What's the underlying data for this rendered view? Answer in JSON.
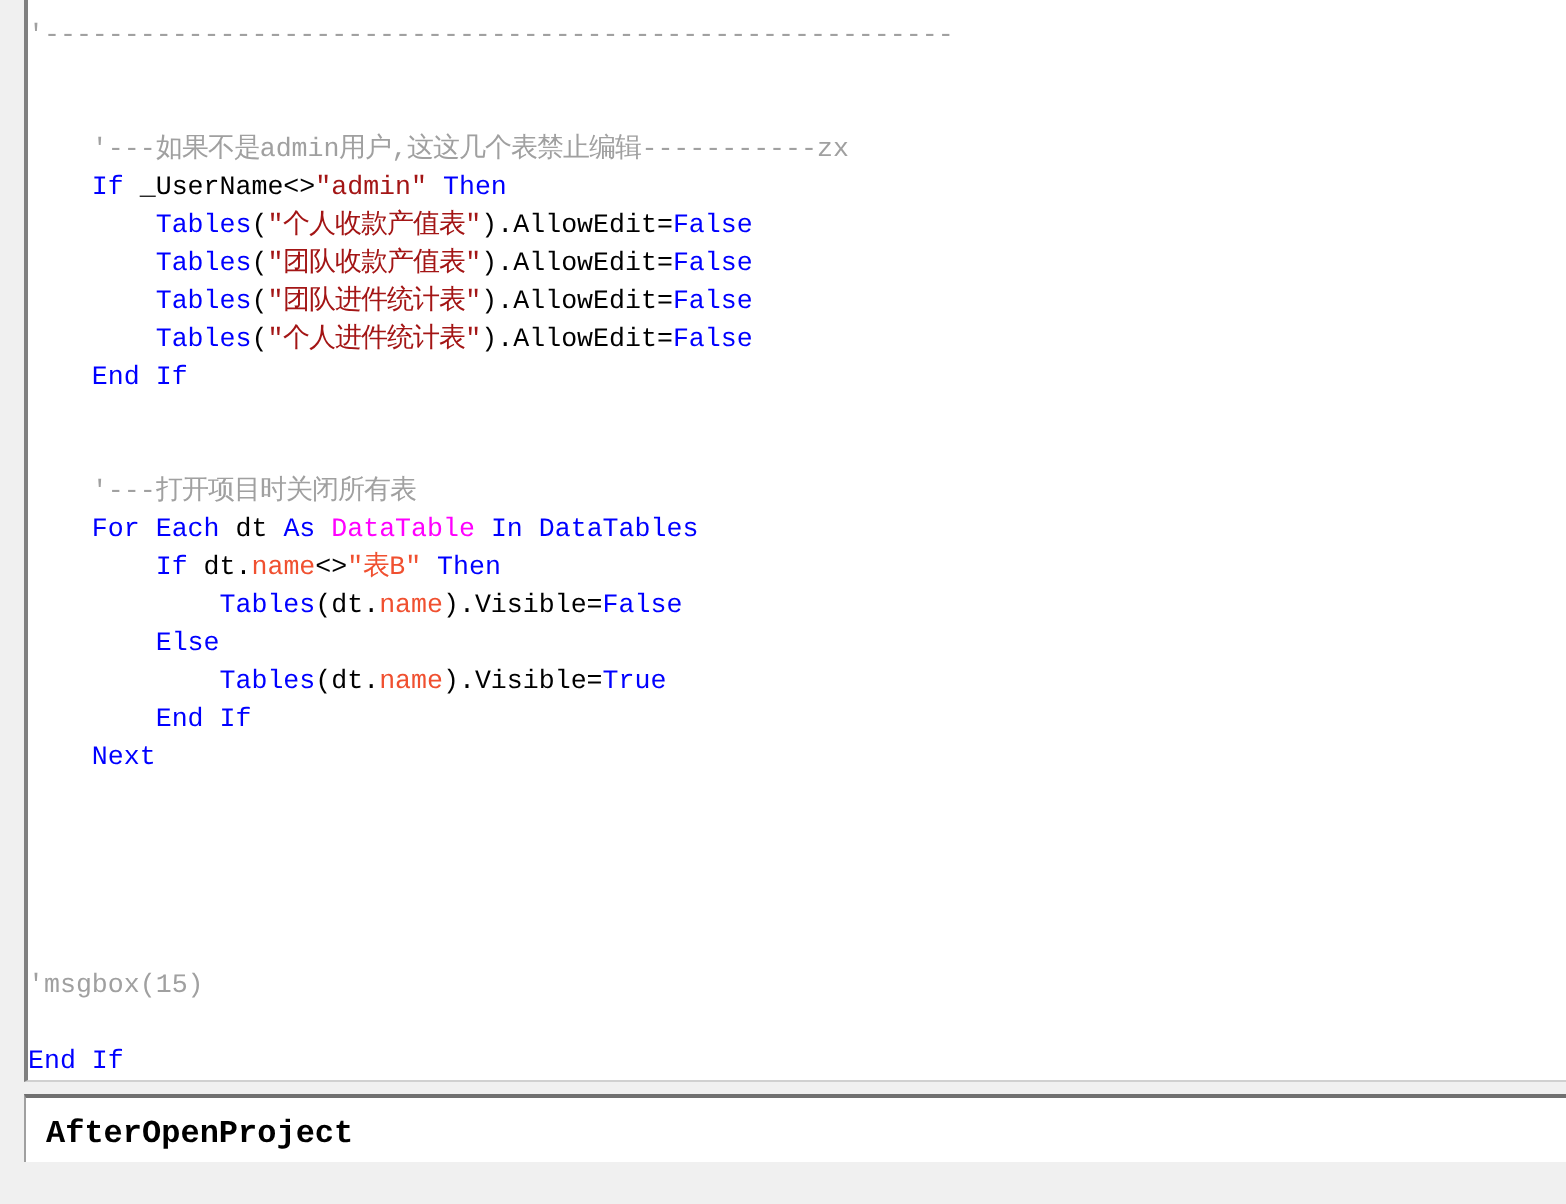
{
  "editor": {
    "lines": [
      {
        "tokens": [
          {
            "kind": "comment",
            "text": "'---------------------------------------------------------"
          }
        ]
      },
      {
        "kind": "blank"
      },
      {
        "kind": "blank"
      },
      {
        "tokens": [
          {
            "kind": "comment",
            "text": "    '---如果不是admin用户,这这几个表禁止编辑-----------zx"
          }
        ]
      },
      {
        "tokens": [
          {
            "kind": "keyword",
            "text": "    If "
          },
          {
            "kind": "plain",
            "text": "_UserName<>"
          },
          {
            "kind": "string",
            "text": "\"admin\""
          },
          {
            "kind": "keyword",
            "text": " Then"
          }
        ]
      },
      {
        "tokens": [
          {
            "kind": "keyword",
            "text": "        Tables"
          },
          {
            "kind": "plain",
            "text": "("
          },
          {
            "kind": "string",
            "text": "\"个人收款产值表\""
          },
          {
            "kind": "plain",
            "text": ").AllowEdit="
          },
          {
            "kind": "keyword",
            "text": "False"
          }
        ]
      },
      {
        "tokens": [
          {
            "kind": "keyword",
            "text": "        Tables"
          },
          {
            "kind": "plain",
            "text": "("
          },
          {
            "kind": "string",
            "text": "\"团队收款产值表\""
          },
          {
            "kind": "plain",
            "text": ").AllowEdit="
          },
          {
            "kind": "keyword",
            "text": "False"
          }
        ]
      },
      {
        "tokens": [
          {
            "kind": "keyword",
            "text": "        Tables"
          },
          {
            "kind": "plain",
            "text": "("
          },
          {
            "kind": "string",
            "text": "\"团队进件统计表\""
          },
          {
            "kind": "plain",
            "text": ").AllowEdit="
          },
          {
            "kind": "keyword",
            "text": "False"
          }
        ]
      },
      {
        "tokens": [
          {
            "kind": "keyword",
            "text": "        Tables"
          },
          {
            "kind": "plain",
            "text": "("
          },
          {
            "kind": "string",
            "text": "\"个人进件统计表\""
          },
          {
            "kind": "plain",
            "text": ").AllowEdit="
          },
          {
            "kind": "keyword",
            "text": "False"
          }
        ]
      },
      {
        "tokens": [
          {
            "kind": "keyword",
            "text": "    End If"
          }
        ]
      },
      {
        "kind": "blank"
      },
      {
        "kind": "blank"
      },
      {
        "tokens": [
          {
            "kind": "comment",
            "text": "    '---打开项目时关闭所有表"
          }
        ]
      },
      {
        "tokens": [
          {
            "kind": "keyword",
            "text": "    For Each "
          },
          {
            "kind": "plain",
            "text": "dt "
          },
          {
            "kind": "keyword",
            "text": "As "
          },
          {
            "kind": "type",
            "text": "DataTable"
          },
          {
            "kind": "keyword",
            "text": " In DataTables"
          }
        ]
      },
      {
        "tokens": [
          {
            "kind": "keyword",
            "text": "        If "
          },
          {
            "kind": "plain",
            "text": "dt."
          },
          {
            "kind": "member",
            "text": "name"
          },
          {
            "kind": "plain",
            "text": "<>"
          },
          {
            "kind": "member",
            "text": "\"表B\""
          },
          {
            "kind": "keyword",
            "text": " Then"
          }
        ]
      },
      {
        "tokens": [
          {
            "kind": "keyword",
            "text": "            Tables"
          },
          {
            "kind": "plain",
            "text": "(dt."
          },
          {
            "kind": "member",
            "text": "name"
          },
          {
            "kind": "plain",
            "text": ").Visible="
          },
          {
            "kind": "keyword",
            "text": "False"
          }
        ]
      },
      {
        "tokens": [
          {
            "kind": "keyword",
            "text": "        Else"
          }
        ]
      },
      {
        "tokens": [
          {
            "kind": "keyword",
            "text": "            Tables"
          },
          {
            "kind": "plain",
            "text": "(dt."
          },
          {
            "kind": "member",
            "text": "name"
          },
          {
            "kind": "plain",
            "text": ").Visible="
          },
          {
            "kind": "keyword",
            "text": "True"
          }
        ]
      },
      {
        "tokens": [
          {
            "kind": "keyword",
            "text": "        End If"
          }
        ]
      },
      {
        "tokens": [
          {
            "kind": "keyword",
            "text": "    Next"
          }
        ]
      },
      {
        "kind": "blank"
      },
      {
        "kind": "blank"
      },
      {
        "kind": "blank"
      },
      {
        "kind": "blank"
      },
      {
        "kind": "blank"
      },
      {
        "tokens": [
          {
            "kind": "comment",
            "text": "'msgbox(15)"
          }
        ]
      },
      {
        "kind": "blank"
      },
      {
        "tokens": [
          {
            "kind": "keyword",
            "text": "End If"
          }
        ]
      }
    ]
  },
  "event_panel": {
    "title": "AfterOpenProject"
  }
}
